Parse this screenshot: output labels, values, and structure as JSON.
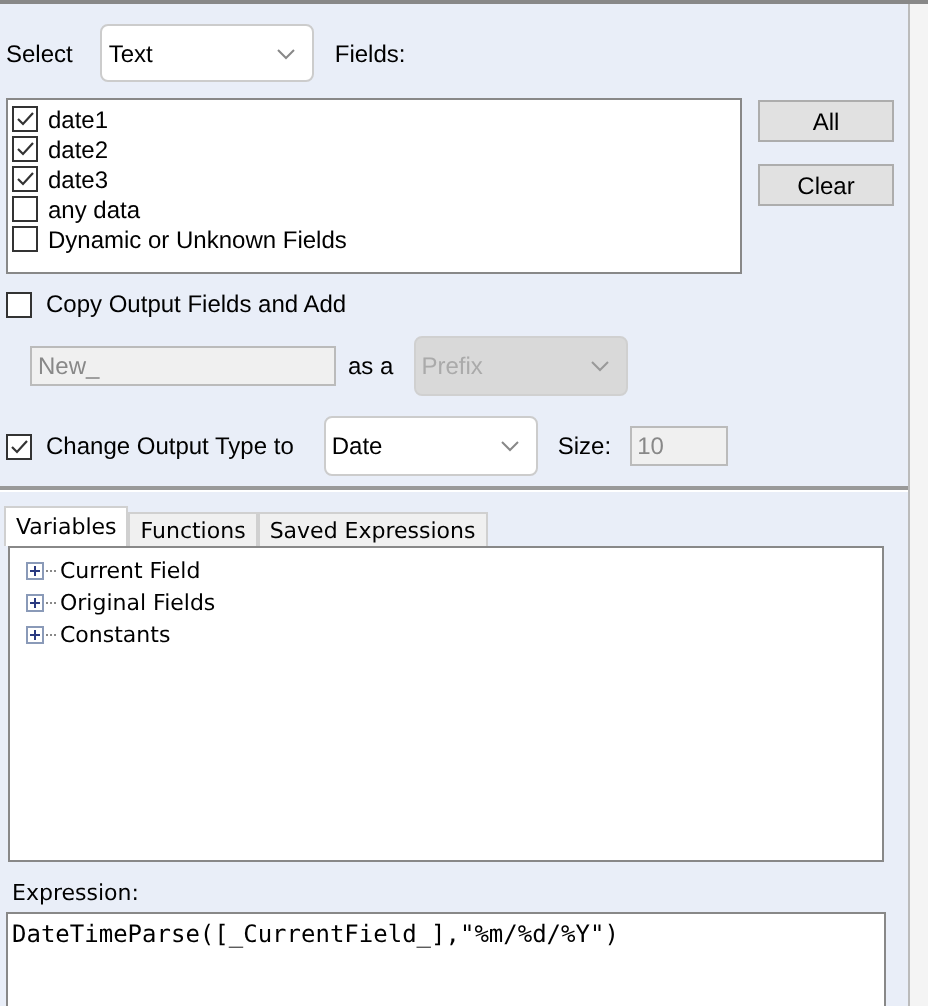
{
  "select": {
    "label": "Select",
    "value": "Text"
  },
  "fields_label": "Fields:",
  "fields": [
    {
      "label": "date1",
      "checked": true
    },
    {
      "label": "date2",
      "checked": true
    },
    {
      "label": "date3",
      "checked": true
    },
    {
      "label": "any data",
      "checked": false
    },
    {
      "label": "Dynamic or Unknown Fields",
      "checked": false
    }
  ],
  "buttons": [
    "All",
    "Clear"
  ],
  "copy_output": {
    "label": "Copy Output Fields and Add",
    "checked": false,
    "value": "New_",
    "as_label": "as a",
    "mode": "Prefix",
    "disabled": true
  },
  "change_type": {
    "label": "Change Output Type to",
    "checked": true,
    "type": "Date",
    "size_label": "Size:",
    "size": "10"
  },
  "tabs": [
    {
      "label": "Variables",
      "selected": true
    },
    {
      "label": "Functions",
      "selected": false
    },
    {
      "label": "Saved Expressions",
      "selected": false
    }
  ],
  "tree": [
    {
      "label": "Current Field",
      "expanded": false
    },
    {
      "label": "Original Fields",
      "expanded": false
    },
    {
      "label": "Constants",
      "expanded": false
    }
  ],
  "expression": {
    "label": "Expression:",
    "value": "DateTimeParse([_CurrentField_],\"%m/%d/%Y\")"
  }
}
